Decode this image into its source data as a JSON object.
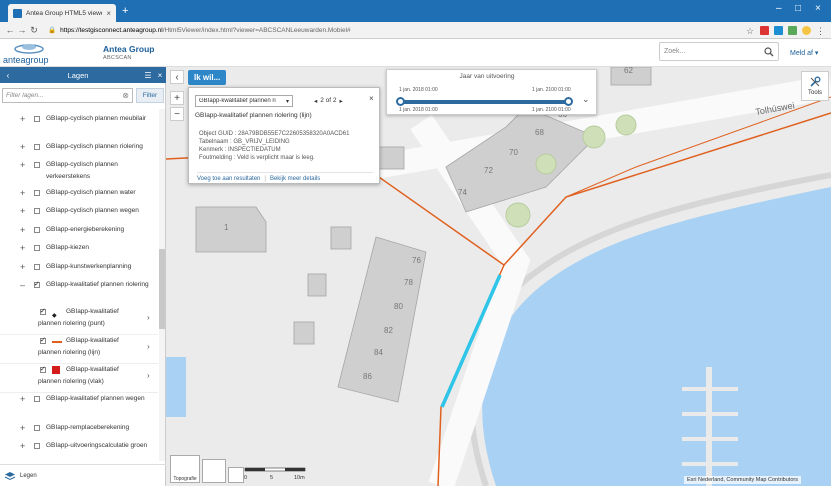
{
  "browser": {
    "tab_title": "Antea Group HTML5 viewer",
    "url_host": "https://testgisconnect.anteagroup.nl",
    "url_path": "/Html5Viewer/index.html?viewer=ABCSCANLeeuwarden.Mobiel#"
  },
  "header": {
    "logo_text": "anteagroup",
    "brand": "Antea Group",
    "sub": "ABCSCAN",
    "search_placeholder": "Zoek...",
    "meld_af": "Meld af"
  },
  "sidebar": {
    "title": "Lagen",
    "filter_placeholder": "Filter lagen...",
    "filter_button": "Filter",
    "layers": [
      {
        "label": "GBIapp-cyclisch plannen meubilair",
        "expanded": false,
        "checked": false
      },
      {
        "label": "GBIapp-cyclisch plannen riolering",
        "expanded": false,
        "checked": false
      },
      {
        "label": "GBIapp-cyclisch plannen verkeerstekens",
        "expanded": false,
        "checked": false
      },
      {
        "label": "GBIapp-cyclisch plannen water",
        "expanded": false,
        "checked": false
      },
      {
        "label": "GBIapp-cyclisch plannen wegen",
        "expanded": false,
        "checked": false
      },
      {
        "label": "GBIapp-energieberekening",
        "expanded": false,
        "checked": false
      },
      {
        "label": "GBIapp-kiezen",
        "expanded": false,
        "checked": false
      },
      {
        "label": "GBIapp-kunstwerkenplanning",
        "expanded": false,
        "checked": false
      },
      {
        "label": "GBIapp-kwalitatief plannen riolering",
        "expanded": true,
        "checked": true
      },
      {
        "label": "GBIapp-kwalitatief plannen riolering (punt)",
        "sub": true,
        "checked": true
      },
      {
        "label": "GBIapp-kwalitatief plannen riolering (lijn)",
        "sub": true,
        "checked": true
      },
      {
        "label": "GBIapp-kwalitatief plannen riolering (vlak)",
        "sub": true,
        "checked": true
      },
      {
        "label": "GBIapp-kwalitatief plannen wegen",
        "expanded": false,
        "checked": false
      },
      {
        "label": "GBIapp-remplaceberekening",
        "expanded": false,
        "checked": false
      },
      {
        "label": "GBIapp-uitvoeringscalculatie groen",
        "expanded": false,
        "checked": false
      }
    ],
    "footer_label": "Legen"
  },
  "map": {
    "ik_wil": "Ik wil...",
    "popup": {
      "select_value": "GBIapp-kwalitatief plannen ri",
      "pager": "2 of 2",
      "heading": "GBIapp-kwalitatief plannen riolering (lijn)",
      "attrs": [
        "Object GUID : 28A79BDB55E7C22605358320A0ACD61",
        "Tabelnaam : GB_VRIJV_LEIDING",
        "Kenmerk : INSPECTIEDATUM",
        "Foutmelding : Veld is verplicht maar is leeg."
      ],
      "link_add": "Voeg toe aan resultaten",
      "link_more": "Bekijk meer details"
    },
    "time_slider": {
      "title": "Jaar van uitvoering",
      "start_top": "1 jan. 2018 01:00",
      "end_top": "1 jan. 2100 01:00",
      "start_bottom": "1 jan. 2018 01:00",
      "end_bottom": "1 jan. 2100 01:00"
    },
    "tools_label": "Tools",
    "street_label": "Tolhúswei",
    "house_numbers": [
      "1",
      "74",
      "72",
      "70",
      "68",
      "66",
      "76",
      "78",
      "80",
      "82",
      "84",
      "86",
      "62"
    ],
    "basemap_label": "Topografie",
    "scale_labels": [
      "0",
      "5",
      "10m"
    ],
    "attribution": "Esri Nederland, Community Map Contributors",
    "brand_color": "#2c6aa0",
    "pipe_color": "#e0601f",
    "highlight_color": "#2ec5e8",
    "water_color": "#a8d1f3"
  }
}
